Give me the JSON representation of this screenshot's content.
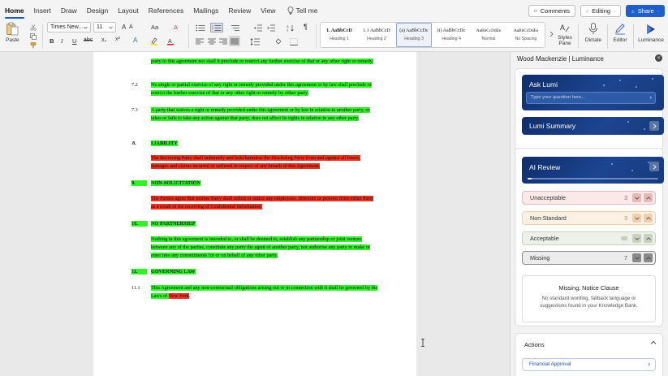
{
  "menu": {
    "tabs": [
      "Home",
      "Insert",
      "Draw",
      "Design",
      "Layout",
      "References",
      "Mailings",
      "Review",
      "View"
    ],
    "tell_me": "Tell me",
    "comments": "Comments",
    "editing": "Editing",
    "share": "Share"
  },
  "ribbon": {
    "paste": "Paste",
    "font_name": "Times New...",
    "font_size": "11",
    "styles": [
      {
        "sample": "1. AaBbCcD",
        "name": "Heading 1"
      },
      {
        "sample": "1.1 AaBbCcD",
        "name": "Heading 2"
      },
      {
        "sample": "(a) AaBbCcDc",
        "name": "Heading 3"
      },
      {
        "sample": "(i) AaBbCcDc",
        "name": "Heading 4"
      },
      {
        "sample": "AaBbCcDdEe",
        "name": "Normal"
      },
      {
        "sample": "AaBbCcDdEe",
        "name": "No Spacing"
      }
    ],
    "styles_pane": "Styles Pane",
    "dictate": "Dictate",
    "editor": "Editor",
    "luminance": "Luminance"
  },
  "document": {
    "para_top": "party to this agreement nor shall it preclude or restrict any further exercise of that or any other right or remedy.",
    "p7_2_num": "7.2",
    "p7_2": "No single or partial exercise of any right or remedy provided under this agreement or by law shall preclude or restrict the further exercise of that or any other right or remedy by either party.",
    "p7_3_num": "7.3",
    "p7_3": "A party that waives a right or remedy provided under this agreement or by law in relation to another party, or takes or fails to take any action against that party, does not affect its rights in relation to any other party.",
    "s8_num": "8.",
    "s8_title": "LIABILITY",
    "s8_text": "The Receiving Party shall indemnify and hold harmless the Disclosing Party from and against all losses, damages and claims incurred or suffered in respect of any breach of this Agreement.",
    "s9_num": "9.",
    "s9_title": "NON-SOLICITATION",
    "s9_text": "The Parties agree that neither Party shall solicit or entice any employees, directors or persons from either Party as a result of the receiving of Confidential Information.",
    "s10_num": "10.",
    "s10_title": "NO PARTNERSHIP",
    "s10_text": "Nothing in this agreement is intended to, or shall be deemed to, establish any partnership or joint venture between any of the parties, constitute any party the agent of another party, nor authorise any party to make or enter into any commitments for or on behalf of any other party.",
    "s11_num": "11.",
    "s11_title": "GOVERNING LAW",
    "p11_1_num": "11.1",
    "p11_1_a": "This Agreement and any non-contractual obligations arising out or in connection with it shall be governed by the Laws of ",
    "p11_1_b": "New York",
    "p11_1_c": "."
  },
  "panel": {
    "title": "Wood Mackenzie | Luminance",
    "ask_lumi": "Ask Lumi",
    "ask_placeholder": "Type your question here...",
    "lumi_summary": "Lumi Summary",
    "ai_review": "AI Review",
    "ai_review_progress": 0.03,
    "statuses": [
      {
        "label": "Unacceptable",
        "count": "3",
        "color": "#d9534f",
        "bg": "#fbe9e9",
        "border": "#e7b9b7"
      },
      {
        "label": "Non-Standard",
        "count": "3",
        "color": "#e08a2c",
        "bg": "#fdf1e3",
        "border": "#efd0ab"
      },
      {
        "label": "Acceptable",
        "count": "98",
        "color": "#8a9a7a",
        "bg": "#eef1ea",
        "border": "#c9d2bf"
      },
      {
        "label": "Missing",
        "count": "7",
        "color": "#555555",
        "bg": "#ececec",
        "border": "#8a8a8a"
      }
    ],
    "missing_title": "Missing: Notice Clause",
    "missing_desc": "No standard wording, fallback language or suggestions found in your Knowledge Bank.",
    "actions_title": "Actions",
    "action_item": "Financial Approval"
  }
}
